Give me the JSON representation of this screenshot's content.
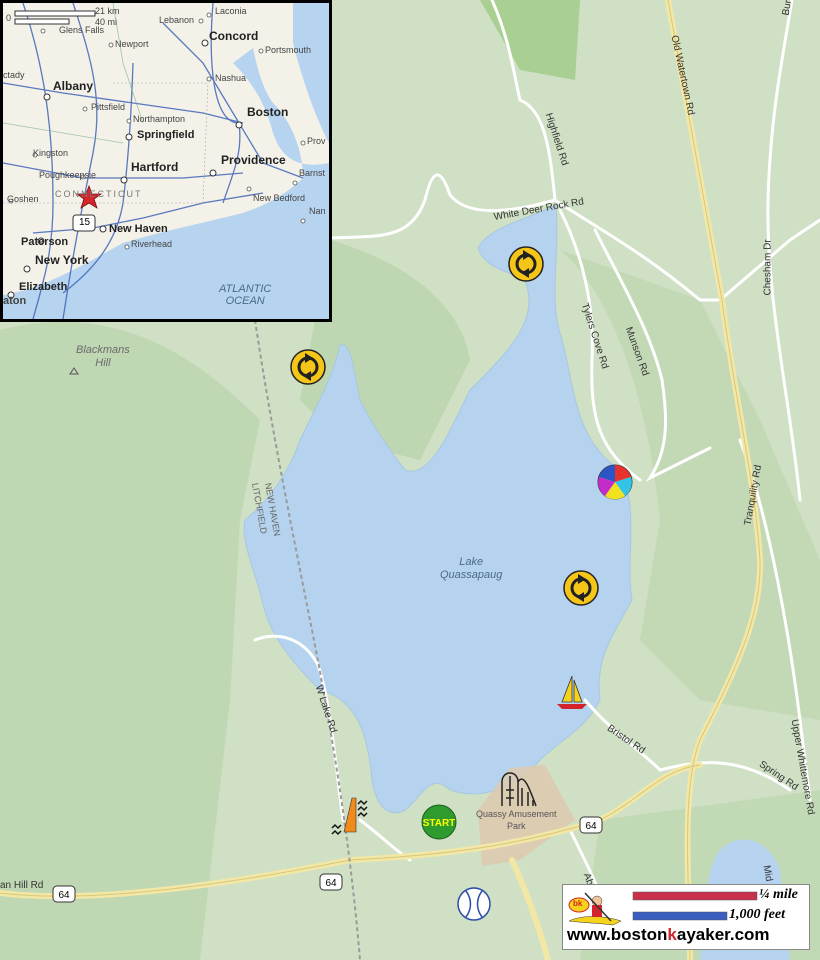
{
  "map": {
    "lake_name": [
      "Lake",
      "Quassapaug"
    ],
    "hill_name": [
      "Blackmans",
      "Hill"
    ],
    "park_name": [
      "Quassy Amusement",
      "Park"
    ],
    "railroad_label_1": "NEW HAVEN",
    "railroad_label_2": "LITCHFIELD",
    "roads": {
      "white_deer_rock": "White Deer Rock Rd",
      "highfield": "Highfield Rd",
      "old_watertown": "Old Watertown Rd",
      "burr_hill": "Burr Hill",
      "tyler_cove": "Tylers Cove Rd",
      "munson": "Munson Rd",
      "chesham": "Chesham Dr",
      "tranquility": "Tranquility Rd",
      "w_lake": "W Lake Rd",
      "bristol": "Bristol Rd",
      "spring": "Spring Rd",
      "upper_whittemore": "Upper Whittemore Rd",
      "abbott": "Abb",
      "mid": "Mid",
      "hill_rd": "an Hill Rd",
      "route_64_a": "64",
      "route_64_b": "64",
      "route_64_c": "64"
    },
    "markers": {
      "start_label": "START"
    }
  },
  "inset": {
    "scale_km": "21 km",
    "scale_mi": "40 mi",
    "scale_zero": "0",
    "cities": [
      "Albany",
      "Concord",
      "Boston",
      "Springfield",
      "Hartford",
      "Providence",
      "New Haven",
      "New York",
      "Paterson",
      "Elizabeth"
    ],
    "towns": [
      "Laconia",
      "Lebanon",
      "Glens Falls",
      "Newport",
      "Portsmouth",
      "Nashua",
      "Pittsfield",
      "Northampton",
      "Kingston",
      "Poughkeepsie",
      "Goshen",
      "New Bedford",
      "Riverhead",
      "Barnst",
      "Prov",
      "Nan",
      "ctady",
      "aton"
    ],
    "state_label": "CONNECTICUT",
    "ocean_label": [
      "ATLANTIC",
      "OCEAN"
    ],
    "route_shield": "15"
  },
  "logo": {
    "quarter_mile": "¼ mile",
    "feet": "1,000 feet",
    "url_prefix": "www.boston",
    "url_k": "k",
    "url_suffix": "ayaker.com",
    "bk_badge": "bk"
  },
  "colors": {
    "water": "#b5d3ee",
    "land": "#c9dcc0",
    "forest_dark": "#b4cfa8",
    "road": "#ffffff",
    "highway": "#f3e7a6",
    "park_area": "#dccab0",
    "scale_red": "#c8314a",
    "scale_blue": "#3b5fbf"
  }
}
